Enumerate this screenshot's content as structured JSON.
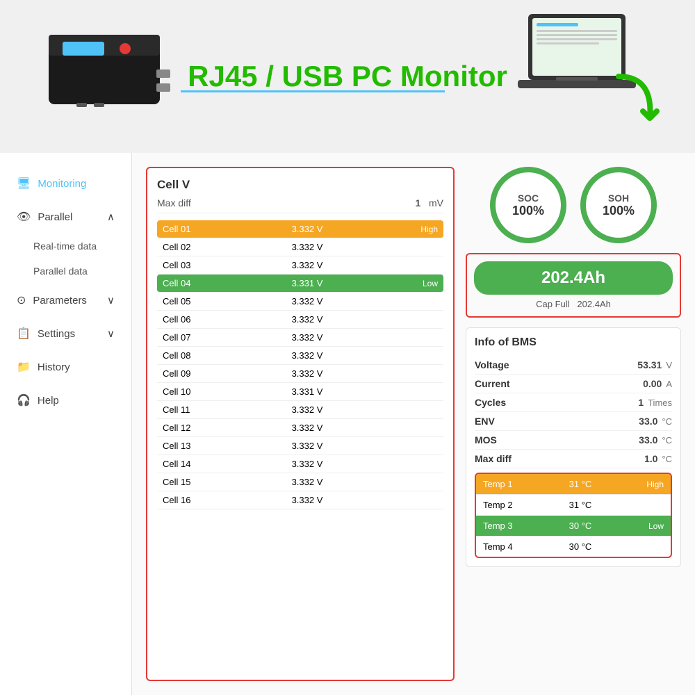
{
  "hero": {
    "title": "RJ45 / USB PC Monitor"
  },
  "sidebar": {
    "items": [
      {
        "id": "monitoring",
        "label": "Monitoring",
        "icon": "🖥",
        "active": true
      },
      {
        "id": "parallel",
        "label": "Parallel",
        "icon": "👁",
        "hasArrow": true
      },
      {
        "id": "real-time-data",
        "label": "Real-time data",
        "sub": true
      },
      {
        "id": "parallel-data",
        "label": "Parallel data",
        "sub": true
      },
      {
        "id": "parameters",
        "label": "Parameters",
        "icon": "⊙",
        "hasArrow": true
      },
      {
        "id": "settings",
        "label": "Settings",
        "icon": "📋",
        "hasArrow": true
      },
      {
        "id": "history",
        "label": "History",
        "icon": "📁"
      },
      {
        "id": "help",
        "label": "Help",
        "icon": "🎧"
      }
    ]
  },
  "cell_panel": {
    "title": "Cell V",
    "max_diff_label": "Max diff",
    "max_diff_value": "1",
    "max_diff_unit": "mV",
    "cells": [
      {
        "name": "Cell 01",
        "voltage": "3.332 V",
        "status": "High",
        "highlight": "orange"
      },
      {
        "name": "Cell 02",
        "voltage": "3.332 V",
        "status": "",
        "highlight": ""
      },
      {
        "name": "Cell 03",
        "voltage": "3.332 V",
        "status": "",
        "highlight": ""
      },
      {
        "name": "Cell 04",
        "voltage": "3.331 V",
        "status": "Low",
        "highlight": "green"
      },
      {
        "name": "Cell 05",
        "voltage": "3.332 V",
        "status": "",
        "highlight": ""
      },
      {
        "name": "Cell 06",
        "voltage": "3.332 V",
        "status": "",
        "highlight": ""
      },
      {
        "name": "Cell 07",
        "voltage": "3.332 V",
        "status": "",
        "highlight": ""
      },
      {
        "name": "Cell 08",
        "voltage": "3.332 V",
        "status": "",
        "highlight": ""
      },
      {
        "name": "Cell 09",
        "voltage": "3.332 V",
        "status": "",
        "highlight": ""
      },
      {
        "name": "Cell 10",
        "voltage": "3.331 V",
        "status": "",
        "highlight": ""
      },
      {
        "name": "Cell 11",
        "voltage": "3.332 V",
        "status": "",
        "highlight": ""
      },
      {
        "name": "Cell 12",
        "voltage": "3.332 V",
        "status": "",
        "highlight": ""
      },
      {
        "name": "Cell 13",
        "voltage": "3.332 V",
        "status": "",
        "highlight": ""
      },
      {
        "name": "Cell 14",
        "voltage": "3.332 V",
        "status": "",
        "highlight": ""
      },
      {
        "name": "Cell 15",
        "voltage": "3.332 V",
        "status": "",
        "highlight": ""
      },
      {
        "name": "Cell 16",
        "voltage": "3.332 V",
        "status": "",
        "highlight": ""
      }
    ]
  },
  "gauges": {
    "soc_label": "SOC",
    "soc_value": "100%",
    "soh_label": "SOH",
    "soh_value": "100%"
  },
  "capacity": {
    "value": "202.4Ah",
    "cap_full_label": "Cap Full",
    "cap_full_value": "202.4Ah"
  },
  "bms": {
    "title": "Info of BMS",
    "rows": [
      {
        "label": "Voltage",
        "value": "53.31",
        "unit": "V"
      },
      {
        "label": "Current",
        "value": "0.00",
        "unit": "A"
      },
      {
        "label": "Cycles",
        "value": "1",
        "unit": "Times"
      },
      {
        "label": "ENV",
        "value": "33.0",
        "unit": "°C"
      },
      {
        "label": "MOS",
        "value": "33.0",
        "unit": "°C"
      },
      {
        "label": "Max diff",
        "value": "1.0",
        "unit": "°C"
      }
    ],
    "temps": [
      {
        "name": "Temp 1",
        "value": "31 °C",
        "status": "High",
        "highlight": "orange"
      },
      {
        "name": "Temp 2",
        "value": "31 °C",
        "status": "",
        "highlight": ""
      },
      {
        "name": "Temp 3",
        "value": "30 °C",
        "status": "Low",
        "highlight": "green"
      },
      {
        "name": "Temp 4",
        "value": "30 °C",
        "status": "",
        "highlight": ""
      }
    ]
  }
}
